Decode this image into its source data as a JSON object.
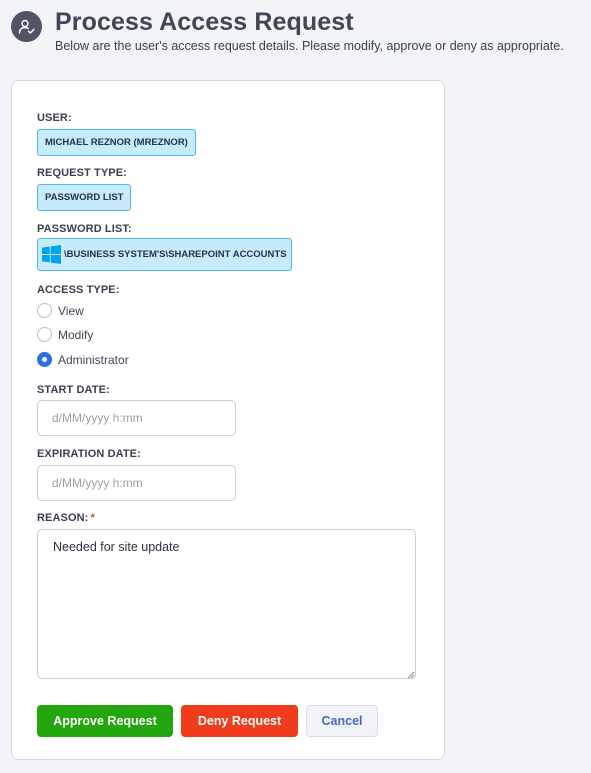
{
  "header": {
    "icon": "user-check-icon",
    "title": "Process Access Request",
    "subtitle": "Below are the user's access request details. Please modify, approve or deny as appropriate."
  },
  "form": {
    "user": {
      "label": "USER:",
      "value": "MICHAEL REZNOR (MREZNOR)"
    },
    "request_type": {
      "label": "REQUEST TYPE:",
      "value": "PASSWORD LIST"
    },
    "password_list": {
      "label": "PASSWORD LIST:",
      "icon": "windows-logo-icon",
      "value": "\\BUSINESS SYSTEM'S\\SHAREPOINT ACCOUNTS"
    },
    "access_type": {
      "label": "ACCESS TYPE:",
      "options": [
        {
          "label": "View",
          "selected": false
        },
        {
          "label": "Modify",
          "selected": false
        },
        {
          "label": "Administrator",
          "selected": true
        }
      ]
    },
    "start_date": {
      "label": "START DATE:",
      "value": "",
      "placeholder": "d/MM/yyyy h:mm"
    },
    "expiration_date": {
      "label": "EXPIRATION DATE:",
      "value": "",
      "placeholder": "d/MM/yyyy h:mm"
    },
    "reason": {
      "label": "REASON:",
      "required_marker": "*",
      "value": "Needed for site update"
    }
  },
  "actions": {
    "approve_label": "Approve Request",
    "deny_label": "Deny Request",
    "cancel_label": "Cancel"
  },
  "colors": {
    "approve": "#23a60e",
    "deny": "#f03c1c",
    "chip_bg": "#c6ebfb",
    "chip_border": "#58b7e2",
    "radio_selected": "#2f6fe0"
  }
}
